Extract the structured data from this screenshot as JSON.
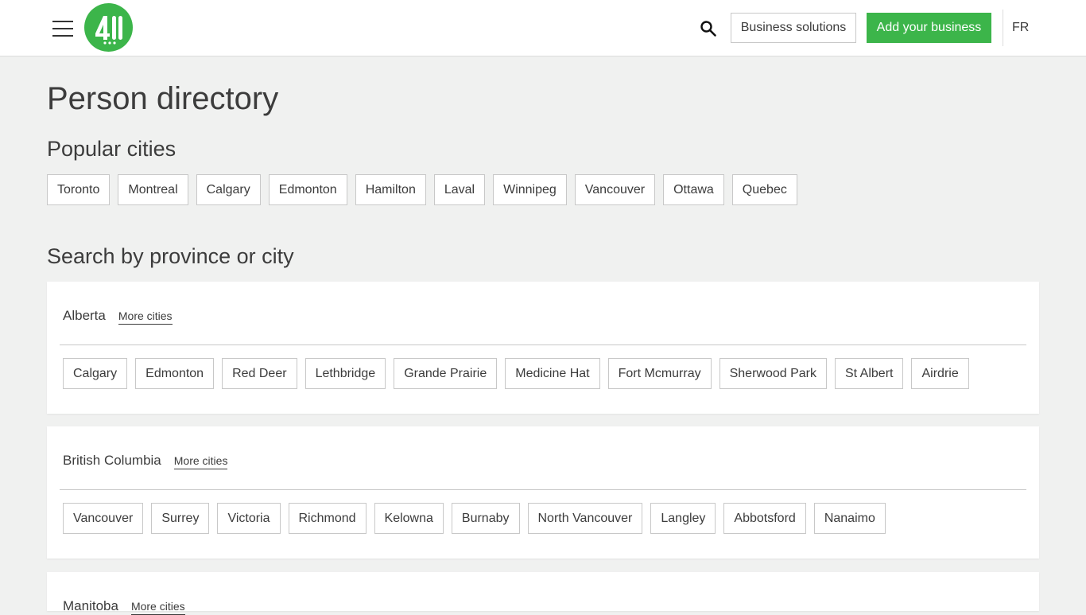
{
  "header": {
    "logo_text": "411.ca",
    "business_solutions_label": "Business solutions",
    "add_business_label": "Add your business",
    "language_label": "FR",
    "accent_color": "#3cb54a"
  },
  "main": {
    "title": "Person directory",
    "popular_title": "Popular cities",
    "popular_cities": [
      "Toronto",
      "Montreal",
      "Calgary",
      "Edmonton",
      "Hamilton",
      "Laval",
      "Winnipeg",
      "Vancouver",
      "Ottawa",
      "Quebec"
    ],
    "search_title": "Search by province or city",
    "provinces": [
      {
        "name": "Alberta",
        "more_label": "More cities",
        "cities": [
          "Calgary",
          "Edmonton",
          "Red Deer",
          "Lethbridge",
          "Grande Prairie",
          "Medicine Hat",
          "Fort Mcmurray",
          "Sherwood Park",
          "St Albert",
          "Airdrie"
        ]
      },
      {
        "name": "British Columbia",
        "more_label": "More cities",
        "cities": [
          "Vancouver",
          "Surrey",
          "Victoria",
          "Richmond",
          "Kelowna",
          "Burnaby",
          "North Vancouver",
          "Langley",
          "Abbotsford",
          "Nanaimo"
        ]
      },
      {
        "name": "Manitoba",
        "more_label": "More cities",
        "cities": []
      }
    ]
  }
}
